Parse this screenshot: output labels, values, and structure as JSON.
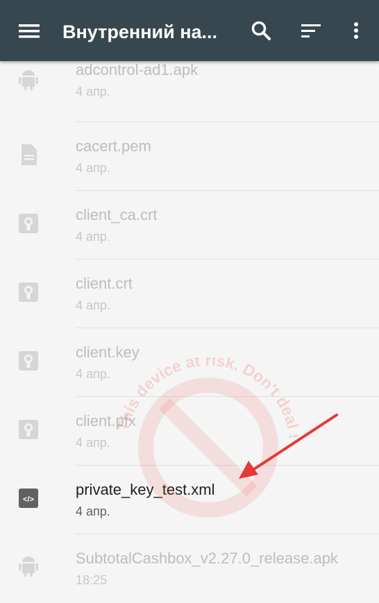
{
  "appbar": {
    "title": "Внутренний на...",
    "icons": [
      "menu-icon",
      "search-icon",
      "sort-icon",
      "more-vert-icon"
    ],
    "color": "#37474f"
  },
  "files": [
    {
      "name": "adcontrol-ad1.apk",
      "date": "4 апр.",
      "icon": "android-icon",
      "active": false
    },
    {
      "name": "cacert.pem",
      "date": "4 апр.",
      "icon": "document-icon",
      "active": false
    },
    {
      "name": "client_ca.crt",
      "date": "4 апр.",
      "icon": "certificate-icon",
      "active": false
    },
    {
      "name": "client.crt",
      "date": "4 апр.",
      "icon": "certificate-icon",
      "active": false
    },
    {
      "name": "client.key",
      "date": "4 апр.",
      "icon": "certificate-icon",
      "active": false
    },
    {
      "name": "client.pfx",
      "date": "4 апр.",
      "icon": "certificate-icon",
      "active": false
    },
    {
      "name": "private_key_test.xml",
      "date": "4 апр.",
      "icon": "code-icon",
      "active": true
    },
    {
      "name": "SubtotalCashbox_v2.27.0_release.apk",
      "date": "18:25",
      "icon": "android-icon",
      "active": false
    }
  ],
  "watermark": {
    "text": "This device at risk. Don't deal !",
    "color": "#e53935"
  },
  "annotation": {
    "arrow_color": "#e53935"
  }
}
